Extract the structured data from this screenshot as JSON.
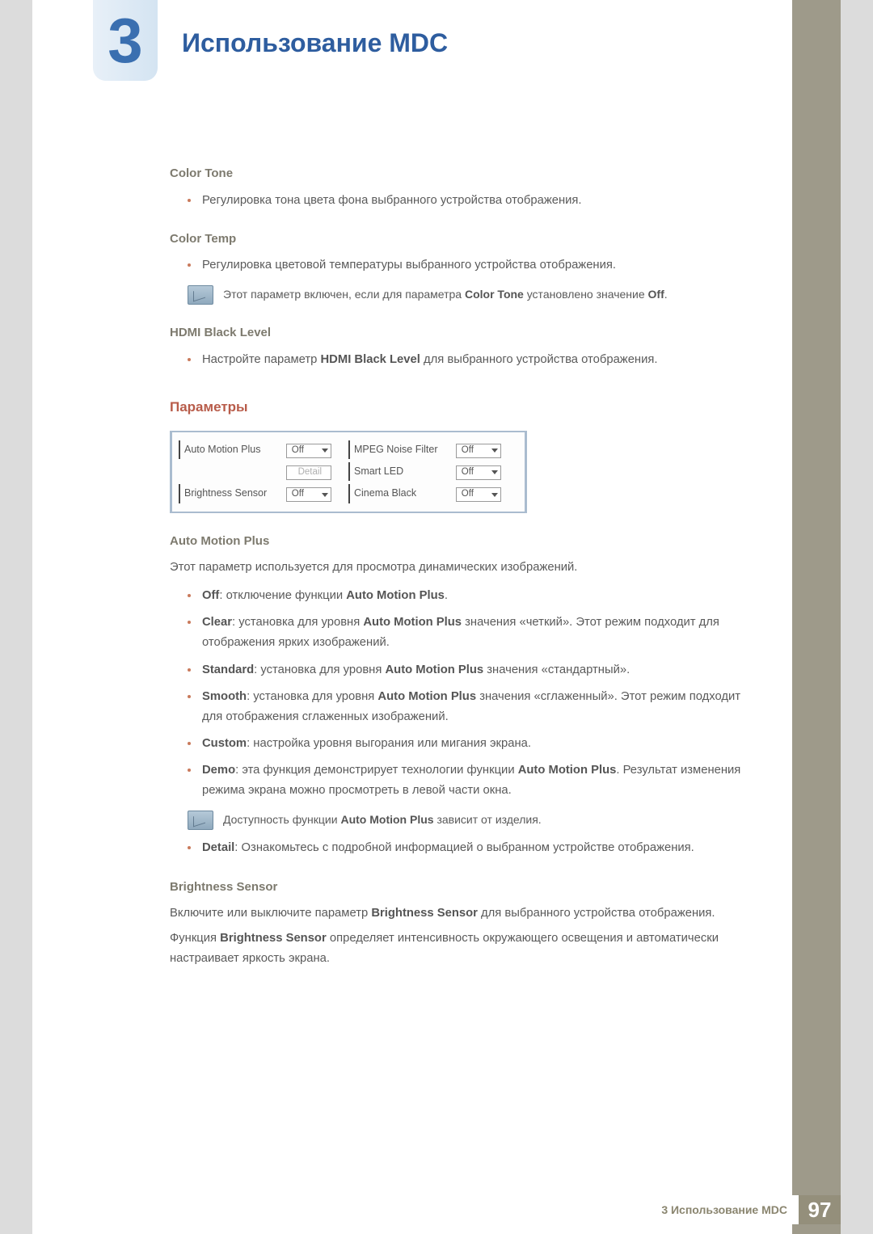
{
  "chapter": {
    "number": "3",
    "title": "Использование MDC"
  },
  "section_colortone": {
    "heading": "Color Tone",
    "bullet": "Регулировка тона цвета фона выбранного устройства отображения."
  },
  "section_colortemp": {
    "heading": "Color Temp",
    "bullet": "Регулировка цветовой температуры выбранного устройства отображения.",
    "note_pre": "Этот параметр включен, если для параметра ",
    "note_bold1": "Color Tone",
    "note_mid": " установлено значение ",
    "note_bold2": "Off",
    "note_end": "."
  },
  "section_hdmi": {
    "heading": "HDMI Black Level",
    "bullet_pre": "Настройте параметр  ",
    "bullet_bold": "HDMI Black Level",
    "bullet_post": " для выбранного устройства отображения."
  },
  "section_params": {
    "heading": "Параметры",
    "panel": {
      "auto_motion_plus_label": "Auto Motion Plus",
      "auto_motion_plus_value": "Off",
      "detail_label": "Detail",
      "brightness_sensor_label": "Brightness Sensor",
      "brightness_sensor_value": "Off",
      "mpeg_label": "MPEG Noise Filter",
      "mpeg_value": "Off",
      "smartled_label": "Smart LED",
      "smartled_value": "Off",
      "cinema_label": "Cinema Black",
      "cinema_value": "Off"
    }
  },
  "section_amp": {
    "heading": "Auto Motion Plus",
    "intro": "Этот параметр используется для просмотра динамических изображений.",
    "items": {
      "off": {
        "bold": "Off",
        "pre": ": отключение функции ",
        "bold2": "Auto Motion Plus",
        "post": "."
      },
      "clear": {
        "bold": "Clear",
        "pre": ": установка для уровня ",
        "bold2": "Auto Motion Plus",
        "post": " значения «четкий». Этот режим подходит для отображения ярких изображений."
      },
      "standard": {
        "bold": "Standard",
        "pre": ": установка для уровня ",
        "bold2": "Auto Motion Plus",
        "post": " значения «стандартный»."
      },
      "smooth": {
        "bold": "Smooth",
        "pre": ": установка для уровня ",
        "bold2": "Auto Motion Plus",
        "post": " значения «сглаженный». Этот режим подходит для отображения сглаженных изображений."
      },
      "custom": {
        "bold": "Custom",
        "post": ": настройка уровня выгорания или мигания экрана."
      },
      "demo": {
        "bold": "Demo",
        "pre": ": эта функция демонстрирует технологии функции ",
        "bold2": "Auto Motion Plus",
        "post": ". Результат изменения режима экрана можно просмотреть в левой части окна."
      },
      "detail": {
        "bold": "Detail",
        "post": ": Ознакомьтесь с подробной информацией о выбранном устройстве отображения."
      }
    },
    "note_pre": "Доступность функции ",
    "note_bold": "Auto Motion Plus",
    "note_post": " зависит от изделия."
  },
  "section_bs": {
    "heading": "Brightness Sensor",
    "p1_pre": "Включите или выключите параметр ",
    "p1_bold": "Brightness Sensor",
    "p1_post": " для выбранного устройства отображения.",
    "p2_pre": "Функция ",
    "p2_bold": "Brightness Sensor",
    "p2_post": " определяет интенсивность окружающего освещения и автоматически настраивает яркость экрана."
  },
  "footer": {
    "label": "3 Использование MDC",
    "pagenum": "97"
  }
}
